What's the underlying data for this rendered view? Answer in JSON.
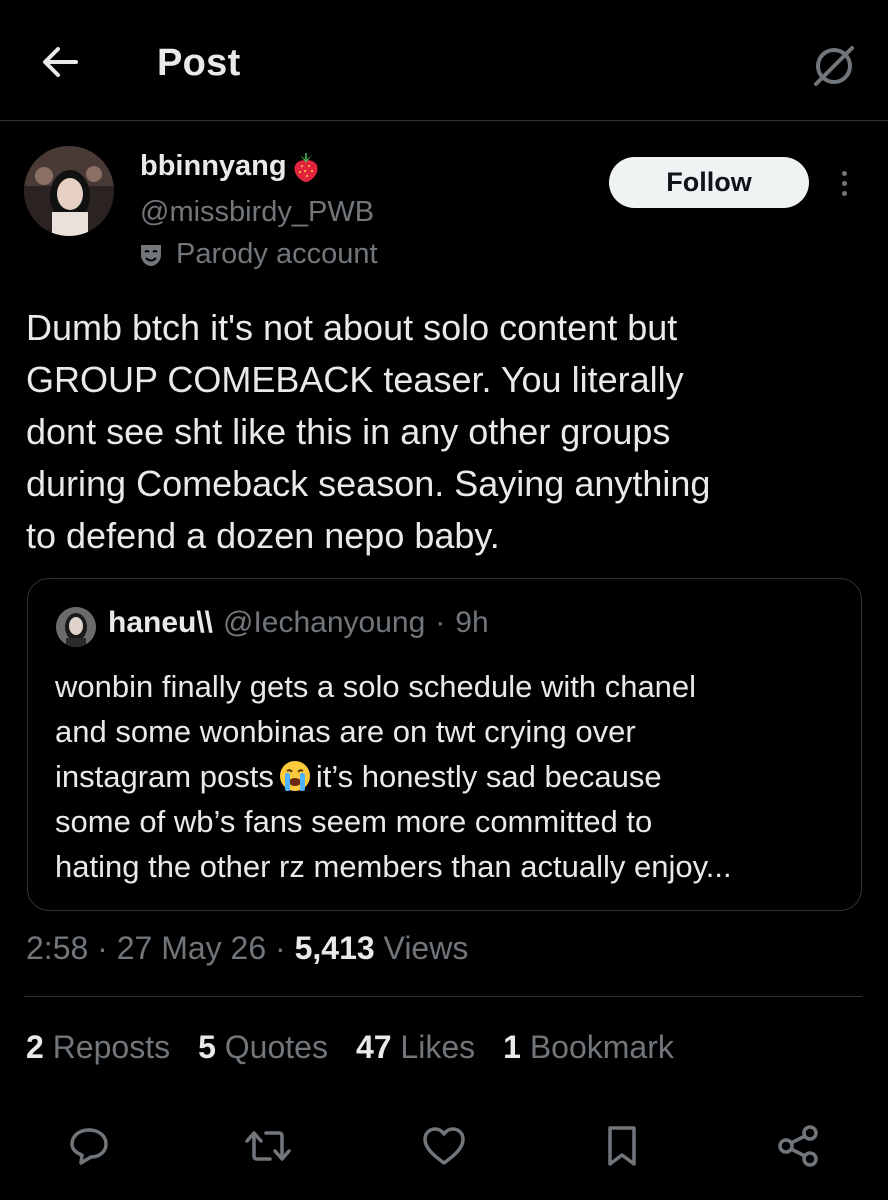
{
  "header": {
    "title": "Post",
    "back_icon": "arrow-left-icon",
    "grok_icon": "grok-icon"
  },
  "author": {
    "display_name": "bbinnyang",
    "name_emoji": "strawberry-icon",
    "handle": "@missbirdy_PWB",
    "parody_label": "Parody account",
    "follow_label": "Follow"
  },
  "post": {
    "lines": [
      "Dumb btch it's not about solo content but",
      "GROUP COMEBACK teaser. You literally",
      "dont see sht like this in any other groups",
      "during Comeback season. Saying anything",
      "to defend a dozen nepo baby."
    ]
  },
  "quote": {
    "name": "haneu\\\\",
    "handle": "@Iechanyoung",
    "dot": "·",
    "time": "9h",
    "line1": "wonbin finally gets a solo schedule with chanel",
    "line2": "and some wonbinas are on twt crying over",
    "line3_a": "instagram posts",
    "line3_b": "it’s honestly sad because",
    "line4": "some of wb’s fans seem more committed to",
    "line5": "hating the other rz members than actually enjoy..."
  },
  "meta": {
    "time": "2:58",
    "sep": "·",
    "date": "27 May 26",
    "views_count": "5,413",
    "views_label": "Views"
  },
  "stats": [
    {
      "num": "2",
      "label": "Reposts"
    },
    {
      "num": "5",
      "label": "Quotes"
    },
    {
      "num": "47",
      "label": "Likes"
    },
    {
      "num": "1",
      "label": "Bookmark"
    }
  ],
  "actions": [
    "reply-icon",
    "repost-icon",
    "like-icon",
    "bookmark-icon",
    "share-icon"
  ],
  "colors": {
    "background": "#000000",
    "text": "#e7e9ea",
    "muted": "#71767b",
    "border": "#2f3336",
    "follow_bg": "#eff3f4"
  }
}
